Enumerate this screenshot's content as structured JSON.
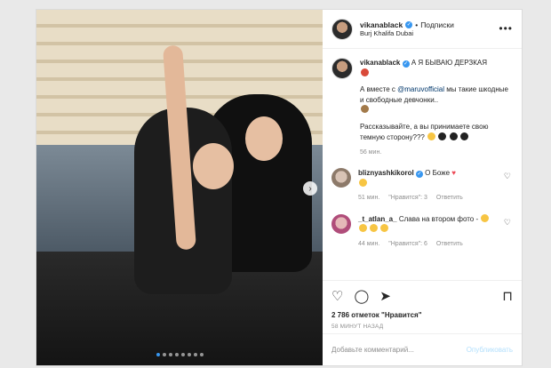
{
  "header": {
    "username": "vikanablack",
    "follow": "Подписки",
    "location": "Burj Khalifa Dubai"
  },
  "caption": {
    "username": "vikanablack",
    "title": "А Я БЫВАЮ ДЕРЗКАЯ",
    "mention": "@maruvofficial",
    "line1_prefix": "А вместе с ",
    "line1_suffix": " мы такие шкодные и свободные девчонки..",
    "line2": "Рассказывайте, а вы принимаете свою темную сторону???",
    "time": "56 мин."
  },
  "comments": [
    {
      "username": "bliznyashkikorol",
      "text": "О Боже",
      "time": "51 мин.",
      "likes": "\"Нравится\": 3",
      "reply": "Ответить"
    },
    {
      "username": "_t_atlan_a_",
      "text": "Слава на втором фото -",
      "time": "44 мин.",
      "likes": "\"Нравится\": 6",
      "reply": "Ответить"
    }
  ],
  "stats": {
    "likes": "2 786 отметок \"Нравится\"",
    "ago": "58 МИНУТ НАЗАД"
  },
  "add_comment": {
    "placeholder": "Добавьте комментарий...",
    "publish": "Опубликовать"
  },
  "colors": {
    "link": "#00376b",
    "verified": "#3897f0",
    "muted": "#8e8e8e",
    "publish_disabled": "#b2dffc"
  }
}
